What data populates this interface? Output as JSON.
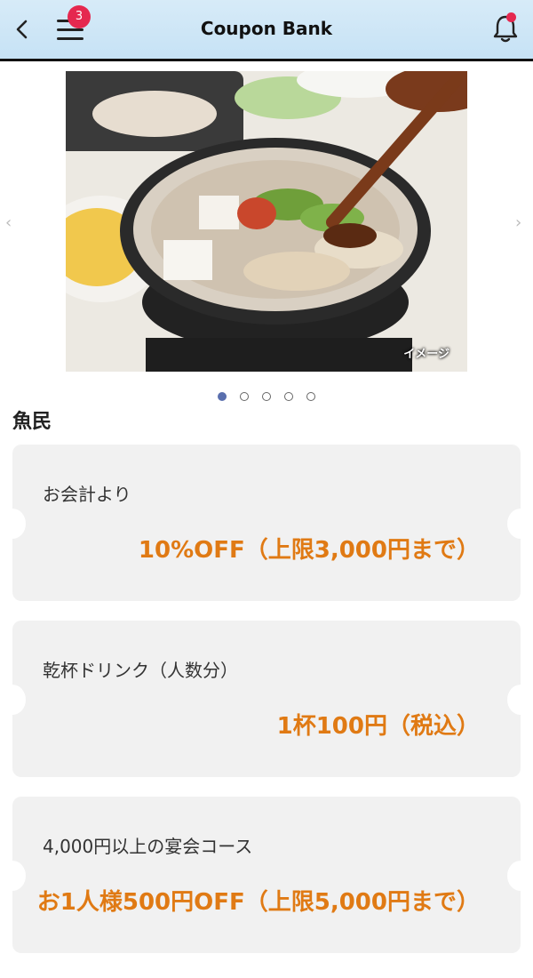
{
  "header": {
    "title": "Coupon Bank",
    "menu_badge": "3"
  },
  "carousel": {
    "image_label": "イメージ",
    "pages": 5,
    "active_index": 0
  },
  "shop": {
    "name": "魚民"
  },
  "coupons": [
    {
      "condition": "お会計より",
      "benefit": "10%OFF（上限3,000円まで）"
    },
    {
      "condition": "乾杯ドリンク（人数分）",
      "benefit": "1杯100円（税込）"
    },
    {
      "condition": "4,000円以上の宴会コース",
      "benefit": "お1人様500円OFF（上限5,000円まで）"
    }
  ],
  "colors": {
    "accent": "#e07a14",
    "badge": "#e5284f",
    "header_bg": "#c6e2f5",
    "card_bg": "#f1f1f1",
    "dot_active": "#5a6fae"
  }
}
